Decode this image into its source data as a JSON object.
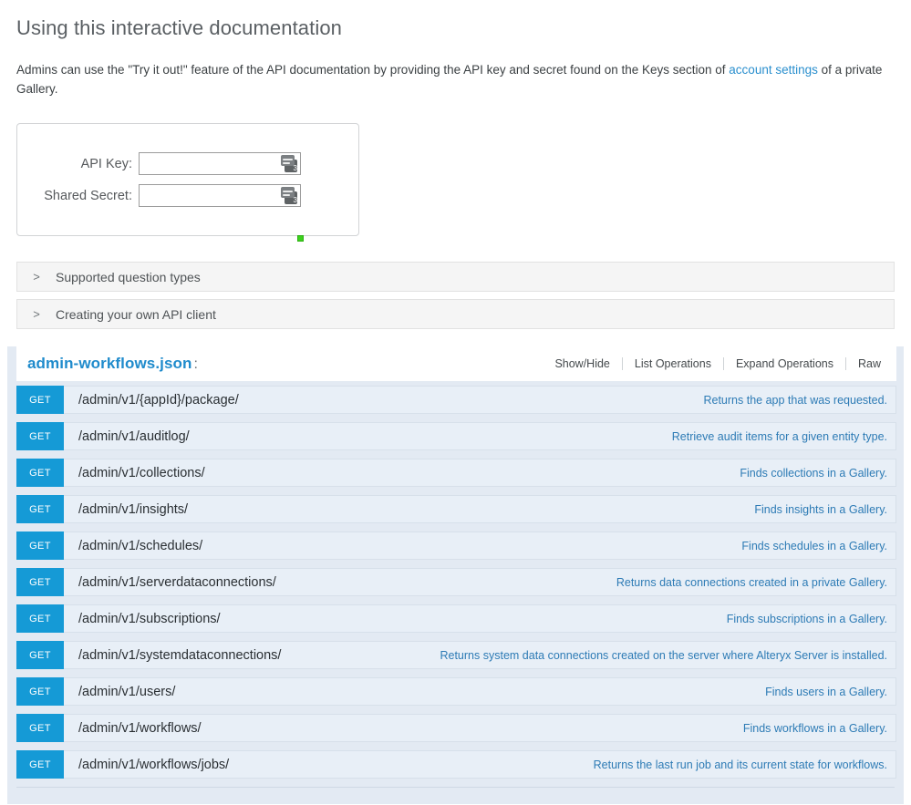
{
  "page": {
    "title": "Using this interactive documentation",
    "intro_before": "Admins can use the \"Try it out!\" feature of the API documentation by providing the API key and secret found on the Keys section of ",
    "intro_link": "account settings",
    "intro_after": " of a private Gallery."
  },
  "credentials": {
    "api_key_label": "API Key:",
    "api_key_value": "",
    "api_key_placeholder": "",
    "shared_secret_label": "Shared Secret:",
    "shared_secret_value": "",
    "shared_secret_placeholder": "",
    "pm_icon_badge": "3",
    "status_dot_color": "#3dd11e"
  },
  "accordion": {
    "chevron": ">",
    "items": [
      {
        "label": "Supported question types"
      },
      {
        "label": "Creating your own API client"
      }
    ]
  },
  "swagger": {
    "api_title": "admin-workflows.json",
    "api_title_colon": ":",
    "accent_color": "#1f8bcc",
    "method_badge_color": "#159ad6",
    "links": [
      {
        "label": "Show/Hide"
      },
      {
        "label": "List Operations"
      },
      {
        "label": "Expand Operations"
      },
      {
        "label": "Raw"
      }
    ],
    "operations": [
      {
        "method": "GET",
        "path": "/admin/v1/{appId}/package/",
        "description": "Returns the app that was requested."
      },
      {
        "method": "GET",
        "path": "/admin/v1/auditlog/",
        "description": "Retrieve audit items for a given entity type."
      },
      {
        "method": "GET",
        "path": "/admin/v1/collections/",
        "description": "Finds collections in a Gallery."
      },
      {
        "method": "GET",
        "path": "/admin/v1/insights/",
        "description": "Finds insights in a Gallery."
      },
      {
        "method": "GET",
        "path": "/admin/v1/schedules/",
        "description": "Finds schedules in a Gallery."
      },
      {
        "method": "GET",
        "path": "/admin/v1/serverdataconnections/",
        "description": "Returns data connections created in a private Gallery."
      },
      {
        "method": "GET",
        "path": "/admin/v1/subscriptions/",
        "description": "Finds subscriptions in a Gallery."
      },
      {
        "method": "GET",
        "path": "/admin/v1/systemdataconnections/",
        "description": "Returns system data connections created on the server where Alteryx Server is installed."
      },
      {
        "method": "GET",
        "path": "/admin/v1/users/",
        "description": "Finds users in a Gallery."
      },
      {
        "method": "GET",
        "path": "/admin/v1/workflows/",
        "description": "Finds workflows in a Gallery."
      },
      {
        "method": "GET",
        "path": "/admin/v1/workflows/jobs/",
        "description": "Returns the last run job and its current state for workflows."
      }
    ]
  }
}
